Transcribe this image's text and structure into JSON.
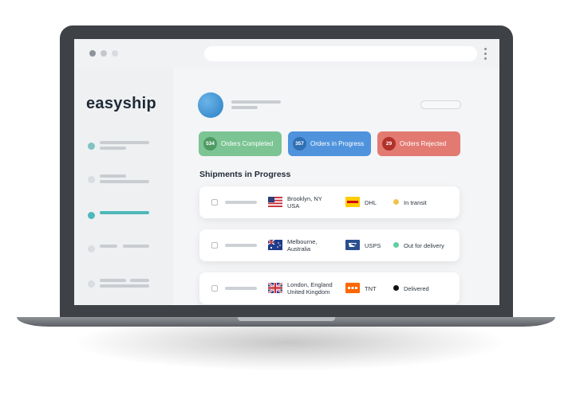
{
  "app": {
    "logo_text": "easyship"
  },
  "stats": [
    {
      "count": "534",
      "label": "Orders Completed",
      "color": "#7cc493"
    },
    {
      "count": "357",
      "label": "Orders in Progress",
      "color": "#4f93dc"
    },
    {
      "count": "29",
      "label": "Orders Rejected",
      "color": "#e27a72"
    }
  ],
  "shipments": {
    "title": "Shipments in Progress",
    "rows": [
      {
        "city_line1": "Brooklyn, NY",
        "city_line2": "USA",
        "flag": "us-flag",
        "carrier": "DHL",
        "status": "In transit",
        "status_color": "#f0c34e"
      },
      {
        "city_line1": "Melbourne,",
        "city_line2": "Australia",
        "flag": "au-flag",
        "carrier": "USPS",
        "status": "Out for delivery",
        "status_color": "#5fcf9f"
      },
      {
        "city_line1": "London, England",
        "city_line2": "United Kingdom",
        "flag": "uk-flag",
        "carrier": "TNT",
        "status": "Delivered",
        "status_color": "#111111"
      }
    ]
  },
  "colors": {
    "accent": "#4fb8b8",
    "laptop_bezel": "#3e4145"
  }
}
